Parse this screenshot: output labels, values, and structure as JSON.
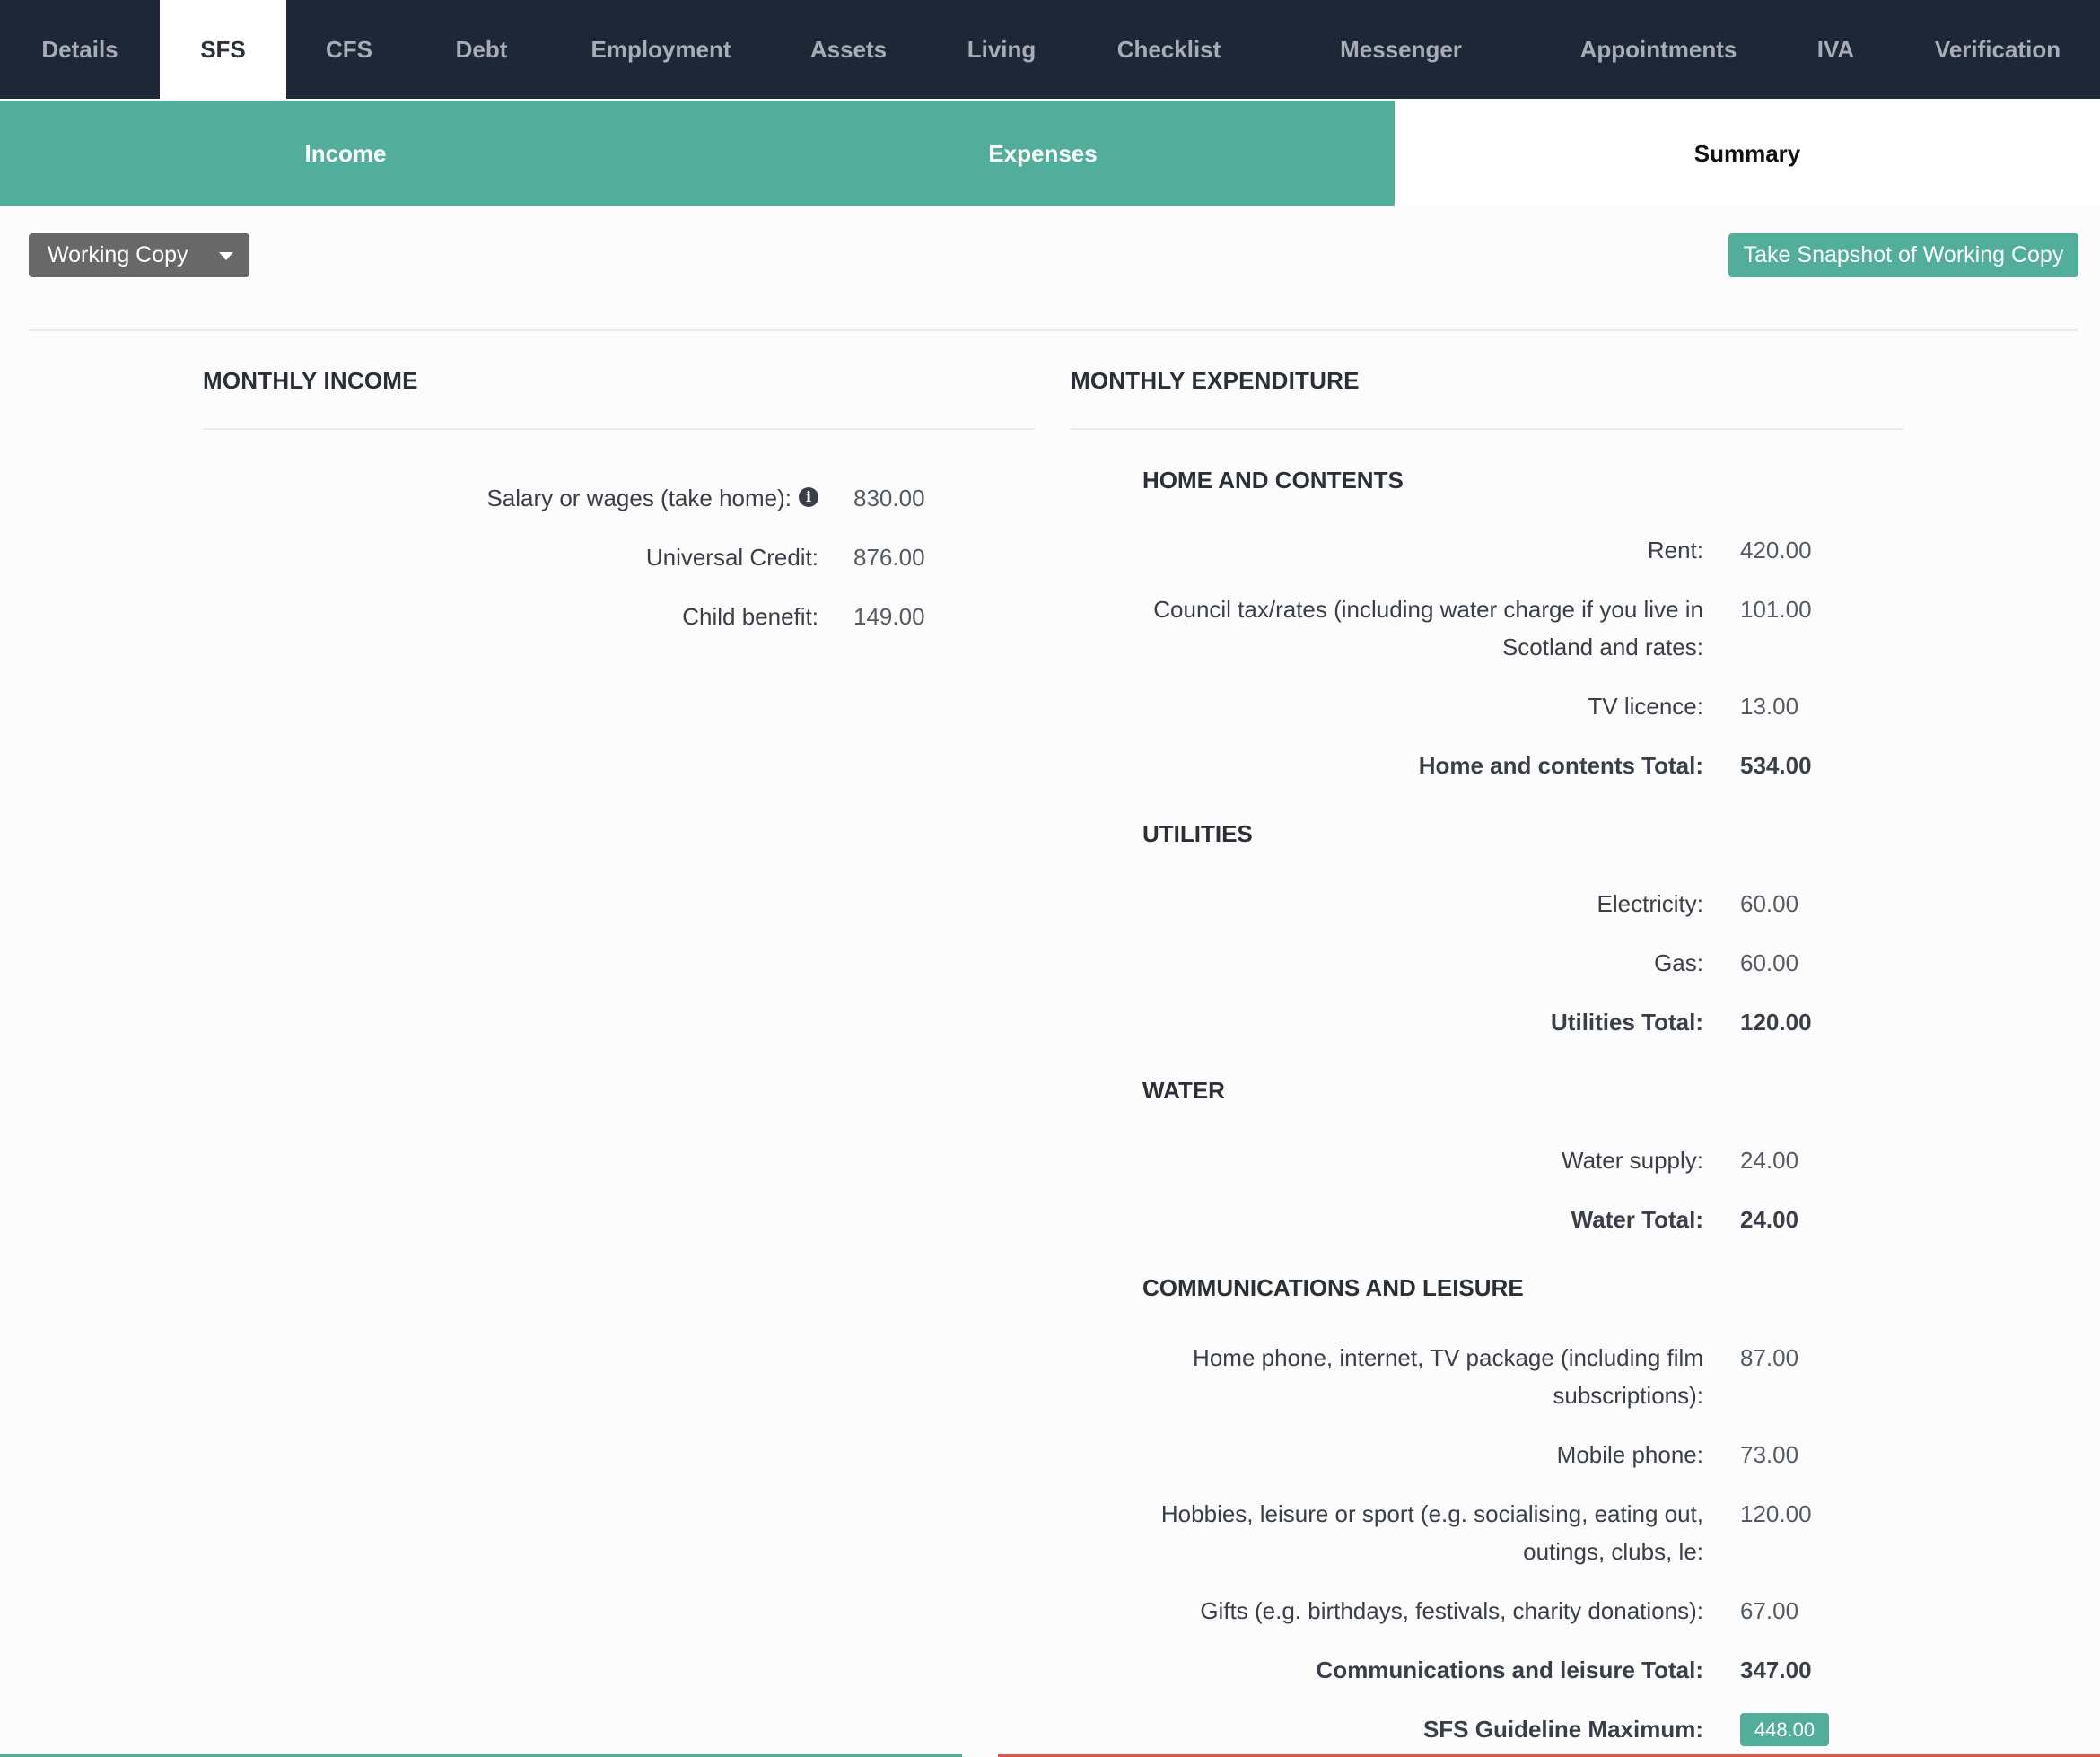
{
  "topnav": {
    "tabs": [
      "Details",
      "SFS",
      "CFS",
      "Debt",
      "Employment",
      "Assets",
      "Living",
      "Checklist",
      "Messenger",
      "Appointments",
      "IVA",
      "Verification"
    ],
    "active": "SFS"
  },
  "subtabs": {
    "income": "Income",
    "expenses": "Expenses",
    "summary": "Summary"
  },
  "controls": {
    "copy_select": "Working Copy",
    "snapshot_button": "Take Snapshot of Working Copy"
  },
  "income": {
    "title": "MONTHLY INCOME",
    "rows": [
      {
        "label": "Salary or wages (take home):",
        "value": "830.00"
      },
      {
        "label": "Universal Credit:",
        "value": "876.00"
      },
      {
        "label": "Child benefit:",
        "value": "149.00"
      }
    ]
  },
  "expenditure": {
    "title": "MONTHLY EXPENDITURE",
    "home": {
      "title": "HOME AND CONTENTS",
      "rent_label": "Rent:",
      "rent": "420.00",
      "council_label_1": "Council tax/rates (including water charge if you live in",
      "council_label_2": "Scotland and rates:",
      "council": "101.00",
      "tv_label": "TV licence:",
      "tv": "13.00",
      "total_label": "Home and contents Total:",
      "total": "534.00"
    },
    "utilities": {
      "title": "UTILITIES",
      "electricity_label": "Electricity:",
      "electricity": "60.00",
      "gas_label": "Gas:",
      "gas": "60.00",
      "total_label": "Utilities Total:",
      "total": "120.00"
    },
    "water": {
      "title": "WATER",
      "supply_label": "Water supply:",
      "supply": "24.00",
      "total_label": "Water Total:",
      "total": "24.00"
    },
    "comms": {
      "title": "COMMUNICATIONS AND LEISURE",
      "phone_label_1": "Home phone, internet, TV package (including film",
      "phone_label_2": "subscriptions):",
      "phone": "87.00",
      "mobile_label": "Mobile phone:",
      "mobile": "73.00",
      "hobbies_label_1": "Hobbies, leisure or sport (e.g. socialising, eating out,",
      "hobbies_label_2": "outings, clubs, le:",
      "hobbies": "120.00",
      "gifts_label": "Gifts (e.g. birthdays, festivals, charity donations):",
      "gifts": "67.00",
      "total_label": "Communications and leisure Total:",
      "total": "347.00",
      "guideline_label": "SFS Guideline Maximum:",
      "guideline": "448.00"
    }
  },
  "colors": {
    "nav_bg": "#1e2738",
    "accent": "#52ae9b",
    "alert": "#e0574b"
  }
}
